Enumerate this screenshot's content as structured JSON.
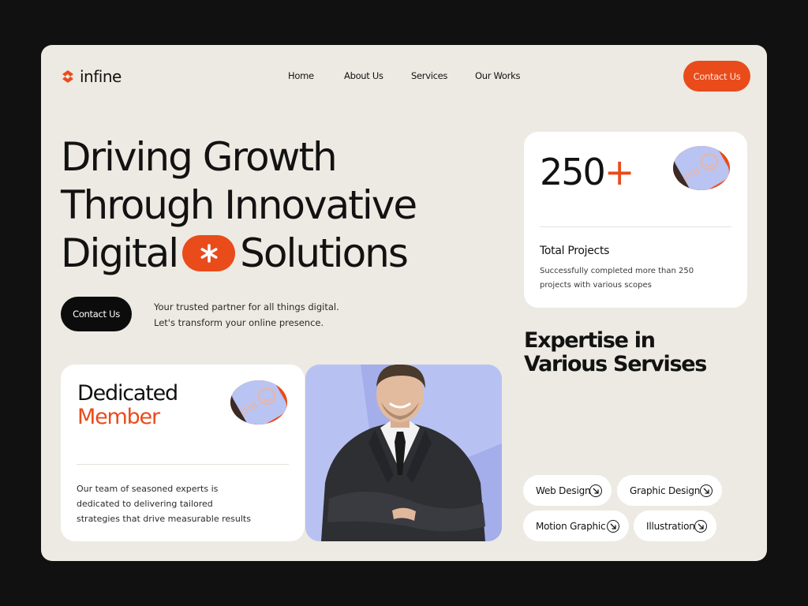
{
  "brand": {
    "name": "infine",
    "accent": "#E94B1B",
    "page_bg": "#ECEAE2",
    "outer_bg": "#111111"
  },
  "nav": {
    "items": [
      "Home",
      "About Us",
      "Services",
      "Our Works"
    ]
  },
  "header": {
    "cta_label": "Contact Us"
  },
  "hero": {
    "line1": "Driving Growth",
    "line2": "Through Innovative",
    "line3_start": "Digital",
    "line3_end": "Solutions",
    "cta_label": "Contact Us",
    "subtitle_line1": "Your trusted partner for all things digital.",
    "subtitle_line2": "Let's transform your online presence."
  },
  "stats": {
    "number": "250",
    "plus": "+",
    "label": "Total Projects",
    "desc_line1": "Successfully completed more than 250",
    "desc_line2": "projects with various scopes"
  },
  "expertise": {
    "title_line1": "Expertise in",
    "title_line2": "Various Servises",
    "services": [
      "Web Design",
      "Graphic Design",
      "Motion Graphic",
      "Illustration"
    ]
  },
  "member": {
    "title": "Dedicated",
    "title_accent": "Member",
    "desc_line1": "Our team of seasoned experts is",
    "desc_line2": "dedicated to delivering tailored",
    "desc_line3": "strategies that drive measurable results"
  },
  "icons": {
    "logo": "infine-logo-icon",
    "asterisk": "asterisk-icon",
    "badge": "pia-badge-icon",
    "arrow": "arrow-down-right-icon"
  }
}
